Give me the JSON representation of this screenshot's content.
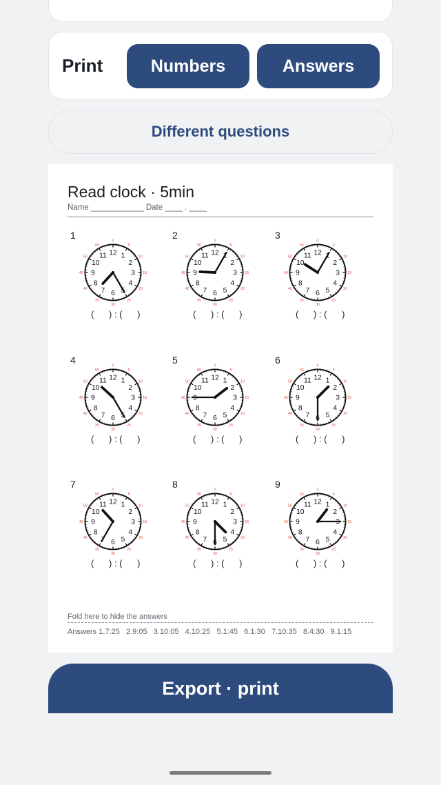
{
  "print_card": {
    "label": "Print",
    "numbers_label": "Numbers",
    "answers_label": "Answers"
  },
  "different_questions_label": "Different questions",
  "sheet": {
    "title": "Read clock · 5min",
    "name_date_line": "Name ____________ Date ____ . ____",
    "answer_blank": "(      ) : (      )",
    "clocks": [
      {
        "label": "1",
        "hour": 7,
        "minute": 25
      },
      {
        "label": "2",
        "hour": 9,
        "minute": 5
      },
      {
        "label": "3",
        "hour": 10,
        "minute": 5
      },
      {
        "label": "4",
        "hour": 10,
        "minute": 25
      },
      {
        "label": "5",
        "hour": 1,
        "minute": 45
      },
      {
        "label": "6",
        "hour": 1,
        "minute": 30
      },
      {
        "label": "7",
        "hour": 10,
        "minute": 35
      },
      {
        "label": "8",
        "hour": 4,
        "minute": 30
      },
      {
        "label": "9",
        "hour": 1,
        "minute": 15
      }
    ],
    "fold_label": "Fold here to hide the answers",
    "answers_line": "Answers 1.7:25   2.9:05   3.10:05   4.10:25   5.1:45   6.1:30   7.10:35   8.4:30   9.1:15"
  },
  "export_label": "Export · print",
  "colors": {
    "accent": "#2e4b7d",
    "minute_marks": "#d9523a"
  }
}
